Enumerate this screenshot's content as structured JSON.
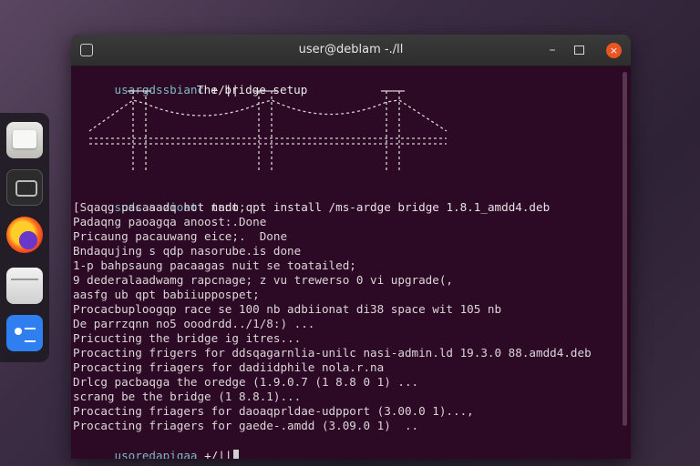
{
  "window": {
    "title": "user@deblam -./ll",
    "close_glyph": "×",
    "minimize_glyph": "–"
  },
  "terminal": {
    "first_prompt": "usargdssbianc",
    "first_prompt_path": " +/||",
    "banner": "The bridge setup",
    "command_prompt": "suds sazioatt",
    "command": " nndo qpt install /ms-ardge bridge 1.8.1_amdd4.deb",
    "output_lines": [
      "[Sqaqg pacaaadq hot tant;",
      "Padaqng paoagqa anoost:.Done",
      "Pricaung pacauwang eice;.  Done",
      "Bndaqujing s qdp nasorube.is done",
      "1-p bahpsaung pacaagas nuit se toatailed;",
      "9 dederalaadwamg rapcnage; z vu trewerso 0 vi upgrade(,",
      "aasfg ub qpt babiiuppospet;",
      "Procacbuploogqp race se 100 nb adbiionat di38 space wit 105 nb",
      "De parrzqnn no5 ooodrdd../1/8:) ...",
      "Pricucting the bridge ig itres...",
      "Procacting frigers for ddsqagarnlia-unilc nasi-admin.ld 19.3.0 88.amdd4.deb",
      "Procacting friagers for dadiidphile nola.r.na",
      "Drlcg pacbaqga the oredge (1.9.0.7 (1 8.8 0 1) ...",
      "scrang be the bridge (1 8.8.1)...",
      "Procacting friagers for daoaqprldae-udpport (3.00.0 1)...,",
      "Procacting friagers for gaede-.amdd (3.09.0 1)  .."
    ],
    "last_prompt": "usoredapiqaa",
    "last_prompt_path": " +/||"
  },
  "colors": {
    "terminal_bg": "#2c0a25",
    "prompt": "#7fb7c4",
    "close_button": "#e95420"
  },
  "dock": {
    "icons": [
      "files-icon",
      "terminal-icon",
      "firefox-icon",
      "app-icon",
      "docs-icon"
    ]
  }
}
